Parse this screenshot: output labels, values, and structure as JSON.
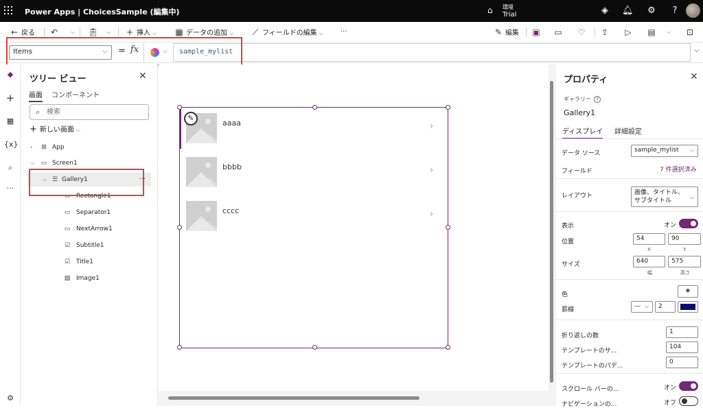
{
  "topbar": {
    "app_title": "Power Apps | ChoicesSample (編集中)",
    "env_label": "環境",
    "env_value": "Trial"
  },
  "cmdbar": {
    "back": "戻る",
    "insert": "挿入",
    "add_data": "データの追加",
    "edit_fields": "フィールドの編集",
    "more": "···",
    "edit": "編集"
  },
  "formula": {
    "property": "Items",
    "equals": "=",
    "fx": "fx",
    "value": "sample_mylist"
  },
  "tree": {
    "title": "ツリー ビュー",
    "tabs": [
      "画面",
      "コンポーネント"
    ],
    "search_placeholder": "検索",
    "new_screen": "新しい画面",
    "nodes": [
      {
        "label": "App",
        "icon": "app-icon"
      },
      {
        "label": "Screen1",
        "icon": "screen-icon"
      },
      {
        "label": "Gallery1",
        "icon": "gallery-icon"
      },
      {
        "label": "Rectangle1",
        "icon": "rectangle-icon"
      },
      {
        "label": "Separator1",
        "icon": "separator-icon"
      },
      {
        "label": "NextArrow1",
        "icon": "arrow-icon"
      },
      {
        "label": "Subtitle1",
        "icon": "label-icon"
      },
      {
        "label": "Title1",
        "icon": "label-icon"
      },
      {
        "label": "Image1",
        "icon": "image-icon"
      }
    ]
  },
  "gallery": {
    "items": [
      {
        "title": "aaaa"
      },
      {
        "title": "bbbb"
      },
      {
        "title": "cccc"
      }
    ]
  },
  "props": {
    "title": "プロパティ",
    "kind": "ギャラリー",
    "control_name": "Gallery1",
    "tabs": [
      "ディスプレイ",
      "詳細設定"
    ],
    "data_source_label": "データ ソース",
    "data_source_value": "sample_mylist",
    "fields_label": "フィールド",
    "fields_value": "7 件選択済み",
    "layout_label": "レイアウト",
    "layout_value": "画像、タイトル、サブタイトル",
    "visible_label": "表示",
    "visible_state": "オン",
    "position_label": "位置",
    "pos_x": "54",
    "pos_y": "90",
    "x_label": "X",
    "y_label": "Y",
    "size_label": "サイズ",
    "width": "640",
    "height": "575",
    "width_label": "幅",
    "height_label": "高さ",
    "color_label": "色",
    "border_label": "罫線",
    "border_style": "—",
    "border_width": "2",
    "border_color": "#0a0a6b",
    "wrap_label": "折り返しの数",
    "wrap_value": "1",
    "template_size_label": "テンプレートのサ...",
    "template_size_value": "104",
    "template_padding_label": "テンプレートのパデ...",
    "template_padding_value": "0",
    "scrollbar_label": "スクロール バーの...",
    "scrollbar_state": "オン",
    "navigation_label": "ナビゲーションの...",
    "navigation_state": "オフ"
  },
  "colors": {
    "accent": "#742774",
    "highlight": "#e43d3d",
    "topbar": "#0b0b0b"
  }
}
